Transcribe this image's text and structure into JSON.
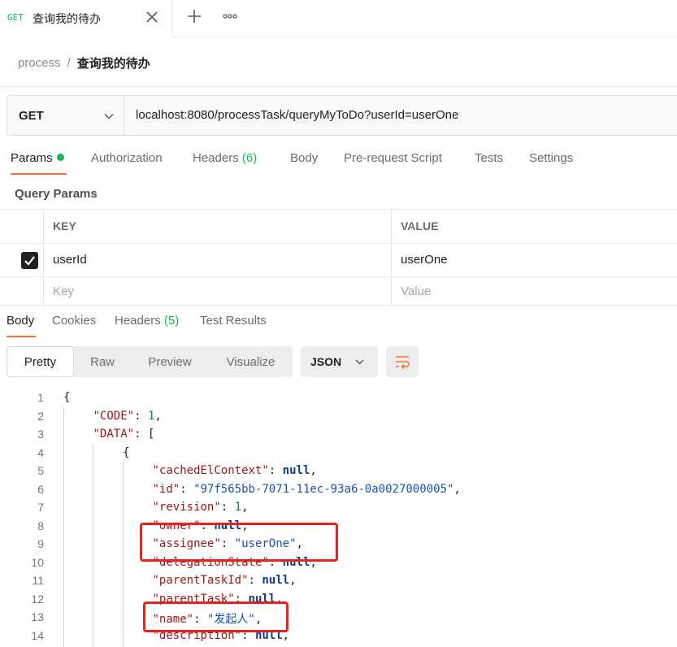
{
  "tab": {
    "method": "GET",
    "name": "查询我的待办"
  },
  "breadcrumb": {
    "parent": "process",
    "separator": "/",
    "current": "查询我的待办"
  },
  "request": {
    "method": "GET",
    "url": "localhost:8080/processTask/queryMyToDo?userId=userOne"
  },
  "request_tabs": [
    {
      "label": "Params",
      "active": true
    },
    {
      "label": "Authorization"
    },
    {
      "label": "Headers",
      "count": "(6)"
    },
    {
      "label": "Body"
    },
    {
      "label": "Pre-request Script"
    },
    {
      "label": "Tests"
    },
    {
      "label": "Settings"
    }
  ],
  "query_params": {
    "title": "Query Params",
    "headers": {
      "key": "KEY",
      "value": "VALUE"
    },
    "rows": [
      {
        "checked": true,
        "key": "userId",
        "value": "userOne"
      }
    ],
    "placeholder": {
      "key": "Key",
      "value": "Value"
    }
  },
  "response_tabs": [
    {
      "label": "Body",
      "active": true
    },
    {
      "label": "Cookies"
    },
    {
      "label": "Headers",
      "count": "(5)"
    },
    {
      "label": "Test Results"
    }
  ],
  "format_tabs": [
    {
      "label": "Pretty",
      "active": true
    },
    {
      "label": "Raw"
    },
    {
      "label": "Preview"
    },
    {
      "label": "Visualize"
    }
  ],
  "language": "JSON",
  "code_lines": [
    {
      "no": "1",
      "indent": 0,
      "tokens": [
        [
          "p",
          "{"
        ]
      ]
    },
    {
      "no": "2",
      "indent": 1,
      "tokens": [
        [
          "k",
          "\"CODE\""
        ],
        [
          "p",
          ": "
        ],
        [
          "n",
          "1"
        ],
        [
          "p",
          ","
        ]
      ]
    },
    {
      "no": "3",
      "indent": 1,
      "tokens": [
        [
          "k",
          "\"DATA\""
        ],
        [
          "p",
          ": ["
        ]
      ]
    },
    {
      "no": "4",
      "indent": 2,
      "tokens": [
        [
          "p",
          "{"
        ]
      ]
    },
    {
      "no": "5",
      "indent": 3,
      "tokens": [
        [
          "k",
          "\"cachedElContext\""
        ],
        [
          "p",
          ": "
        ],
        [
          "kw",
          "null"
        ],
        [
          "p",
          ","
        ]
      ]
    },
    {
      "no": "6",
      "indent": 3,
      "tokens": [
        [
          "k",
          "\"id\""
        ],
        [
          "p",
          ": "
        ],
        [
          "s",
          "\"97f565bb-7071-11ec-93a6-0a0027000005\""
        ],
        [
          "p",
          ","
        ]
      ]
    },
    {
      "no": "7",
      "indent": 3,
      "tokens": [
        [
          "k",
          "\"revision\""
        ],
        [
          "p",
          ": "
        ],
        [
          "n",
          "1"
        ],
        [
          "p",
          ","
        ]
      ]
    },
    {
      "no": "8",
      "indent": 3,
      "tokens": [
        [
          "k",
          "\"owner\""
        ],
        [
          "p",
          ": "
        ],
        [
          "kw",
          "null"
        ],
        [
          "p",
          ","
        ]
      ]
    },
    {
      "no": "9",
      "indent": 3,
      "tokens": [
        [
          "k",
          "\"assignee\""
        ],
        [
          "p",
          ": "
        ],
        [
          "s",
          "\"userOne\""
        ],
        [
          "p",
          ","
        ]
      ]
    },
    {
      "no": "10",
      "indent": 3,
      "tokens": [
        [
          "k",
          "\"delegationState\""
        ],
        [
          "p",
          ": "
        ],
        [
          "kw",
          "null"
        ],
        [
          "p",
          ","
        ]
      ]
    },
    {
      "no": "11",
      "indent": 3,
      "tokens": [
        [
          "k",
          "\"parentTaskId\""
        ],
        [
          "p",
          ": "
        ],
        [
          "kw",
          "null"
        ],
        [
          "p",
          ","
        ]
      ]
    },
    {
      "no": "12",
      "indent": 3,
      "tokens": [
        [
          "k",
          "\"parentTask\""
        ],
        [
          "p",
          ": "
        ],
        [
          "kw",
          "null"
        ],
        [
          "p",
          ","
        ]
      ]
    },
    {
      "no": "13",
      "indent": 3,
      "tokens": [
        [
          "k",
          "\"name\""
        ],
        [
          "p",
          ": "
        ],
        [
          "s",
          "\"发起人\""
        ],
        [
          "p",
          ","
        ]
      ]
    },
    {
      "no": "14",
      "indent": 3,
      "tokens": [
        [
          "k",
          "\"description\""
        ],
        [
          "p",
          ": "
        ],
        [
          "kw",
          "null"
        ],
        [
          "p",
          ","
        ]
      ]
    }
  ],
  "colors": {
    "accent": "#ff6c37",
    "get_method": "#0cbb52",
    "highlight_box": "#e8201e"
  }
}
